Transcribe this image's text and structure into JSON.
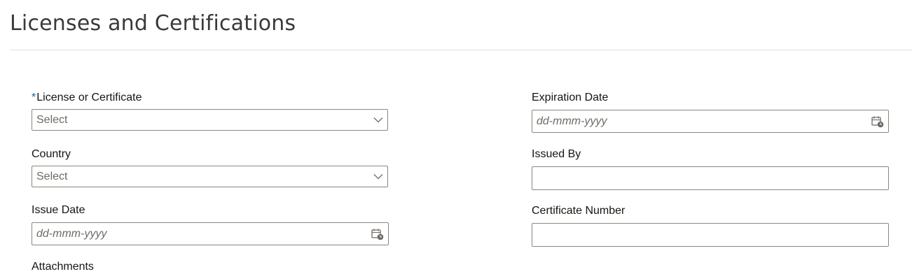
{
  "page": {
    "title": "Licenses and Certifications"
  },
  "form": {
    "license": {
      "required_mark": "*",
      "label": "License or Certificate",
      "value": "Select"
    },
    "country": {
      "label": "Country",
      "value": "Select"
    },
    "issue_date": {
      "label": "Issue Date",
      "placeholder": "dd-mmm-yyyy"
    },
    "attachments": {
      "label": "Attachments"
    },
    "expiration_date": {
      "label": "Expiration Date",
      "placeholder": "dd-mmm-yyyy"
    },
    "issued_by": {
      "label": "Issued By",
      "value": ""
    },
    "certificate_number": {
      "label": "Certificate Number",
      "value": ""
    }
  },
  "icons": {
    "select_chevron": "chevron-down-icon",
    "date_picker": "calendar-icon"
  },
  "colors": {
    "required": "#1a5fb4",
    "border": "#8c877f",
    "divider": "#e3e1de"
  }
}
